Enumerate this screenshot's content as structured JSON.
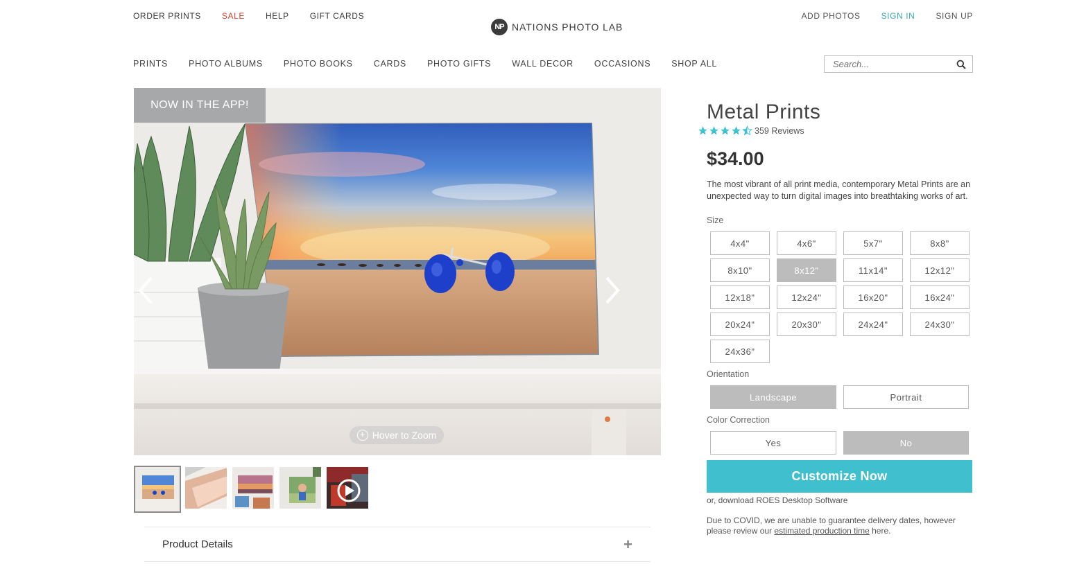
{
  "top_links": {
    "order_prints": "ORDER PRINTS",
    "sale": "SALE",
    "help": "HELP",
    "gift_cards": "GIFT CARDS"
  },
  "logo": {
    "badge": "NP",
    "text": "NATIONS PHOTO LAB"
  },
  "account": {
    "add_photos": "ADD PHOTOS",
    "sign_in": "SIGN IN",
    "sign_up": "SIGN UP"
  },
  "nav": {
    "prints": "PRINTS",
    "photo_albums": "PHOTO ALBUMS",
    "photo_books": "PHOTO BOOKS",
    "cards": "CARDS",
    "photo_gifts": "PHOTO GIFTS",
    "wall_decor": "WALL DECOR",
    "occasions": "OCCASIONS",
    "shop_all": "SHOP ALL"
  },
  "search": {
    "placeholder": "Search..."
  },
  "hero": {
    "app_badge": "NOW IN THE APP!",
    "zoom_label": "Hover to Zoom"
  },
  "details": {
    "label": "Product Details"
  },
  "product": {
    "title": "Metal Prints",
    "rating": 4.5,
    "reviews": "359 Reviews",
    "price": "$34.00",
    "description": "The most vibrant of all print media, contemporary Metal Prints are an unexpected way to turn digital images into breathtaking works of art."
  },
  "size": {
    "label": "Size",
    "options": [
      "4x4\"",
      "4x6\"",
      "5x7\"",
      "8x8\"",
      "8x10\"",
      "8x12\"",
      "11x14\"",
      "12x12\"",
      "12x18\"",
      "12x24\"",
      "16x20\"",
      "16x24\"",
      "20x24\"",
      "20x30\"",
      "24x24\"",
      "24x30\"",
      "24x36\""
    ],
    "selected": "8x12\""
  },
  "orientation": {
    "label": "Orientation",
    "landscape": "Landscape",
    "portrait": "Portrait"
  },
  "color_correction": {
    "label": "Color Correction",
    "yes": "Yes",
    "no": "No"
  },
  "cta": {
    "label": "Customize Now"
  },
  "roes": {
    "text": "or, download ROES Desktop Software"
  },
  "covid": {
    "pre": "Due to COVID, we are unable to guarantee delivery dates, however please review our ",
    "link": "estimated production time",
    "post": " here."
  },
  "colors": {
    "accent": "#40bfcf",
    "sale": "#d9412e",
    "star": "#3fc1d0",
    "selected_option": "#bcbcbc"
  }
}
